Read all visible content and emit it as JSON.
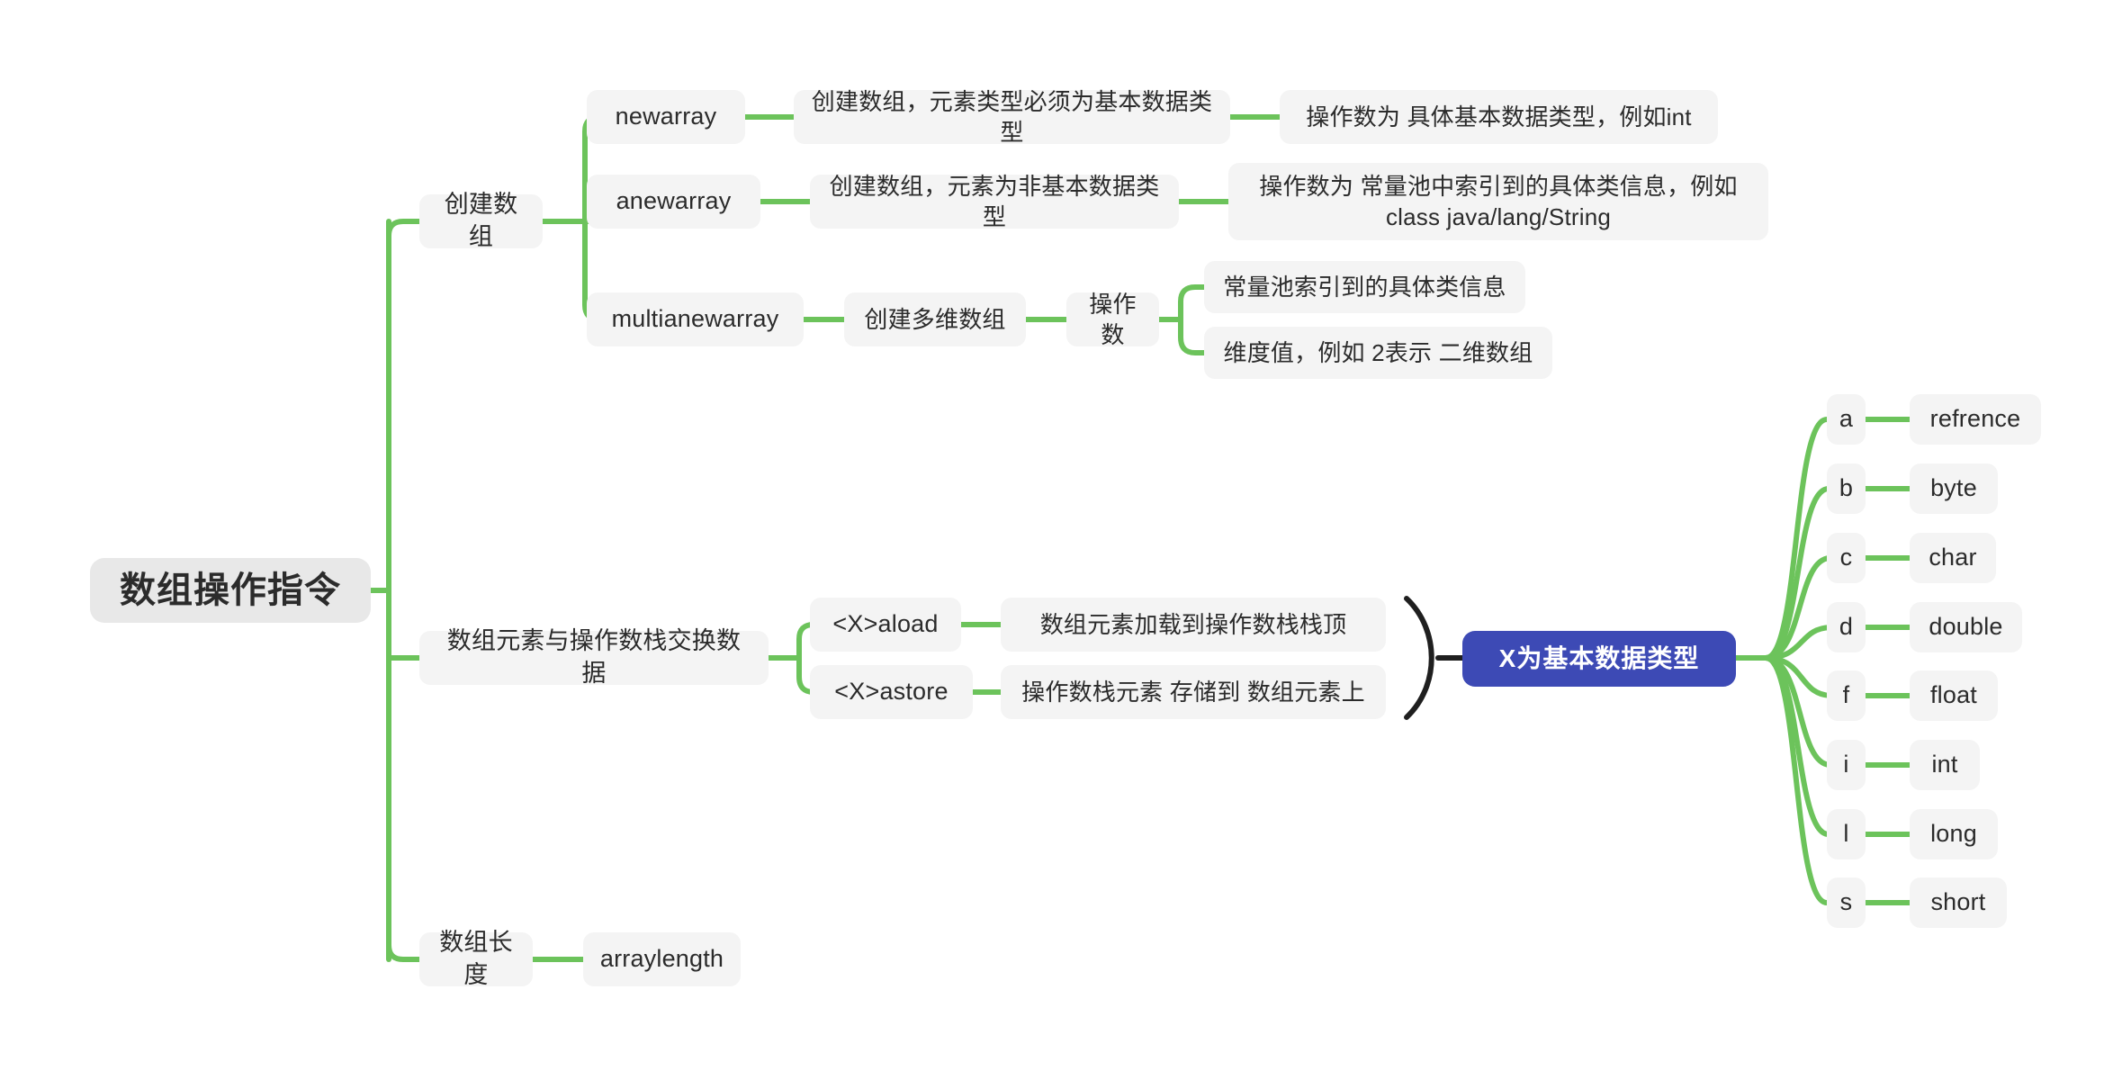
{
  "theme": {
    "background": "#ffffff",
    "edge_color": "#6cc35b",
    "node_bg": "#f4f4f4",
    "root_bg": "#e8e8e8",
    "text_color": "#2b2b2b",
    "accent_bg": "#3d4ab5",
    "accent_text": "#ffffff",
    "brace_color": "#1f1f1f"
  },
  "root": {
    "label": "数组操作指令"
  },
  "branches": {
    "create_array": {
      "label": "创建数组",
      "items": [
        {
          "name": "newarray",
          "desc": "创建数组，元素类型必须为基本数据类型",
          "detail": "操作数为 具体基本数据类型，例如int"
        },
        {
          "name": "anewarray",
          "desc": "创建数组，元素为非基本数据类型",
          "detail": "操作数为 常量池中索引到的具体类信息，例如\nclass java/lang/String"
        },
        {
          "name": "multianewarray",
          "desc": "创建多维数组",
          "operand_label": "操作数",
          "operands": [
            "常量池索引到的具体类信息",
            "维度值，例如 2表示 二维数组"
          ]
        }
      ]
    },
    "exchange": {
      "label": "数组元素与操作数栈交换数据",
      "items": [
        {
          "name": "<X>aload",
          "desc": "数组元素加载到操作数栈栈顶"
        },
        {
          "name": "<X>astore",
          "desc": "操作数栈元素 存储到 数组元素上"
        }
      ],
      "note": "X为基本数据类型",
      "types": [
        {
          "letter": "a",
          "type": "refrence"
        },
        {
          "letter": "b",
          "type": "byte"
        },
        {
          "letter": "c",
          "type": "char"
        },
        {
          "letter": "d",
          "type": "double"
        },
        {
          "letter": "f",
          "type": "float"
        },
        {
          "letter": "i",
          "type": "int"
        },
        {
          "letter": "l",
          "type": "long"
        },
        {
          "letter": "s",
          "type": "short"
        }
      ]
    },
    "length": {
      "label": "数组长度",
      "item": "arraylength"
    }
  }
}
